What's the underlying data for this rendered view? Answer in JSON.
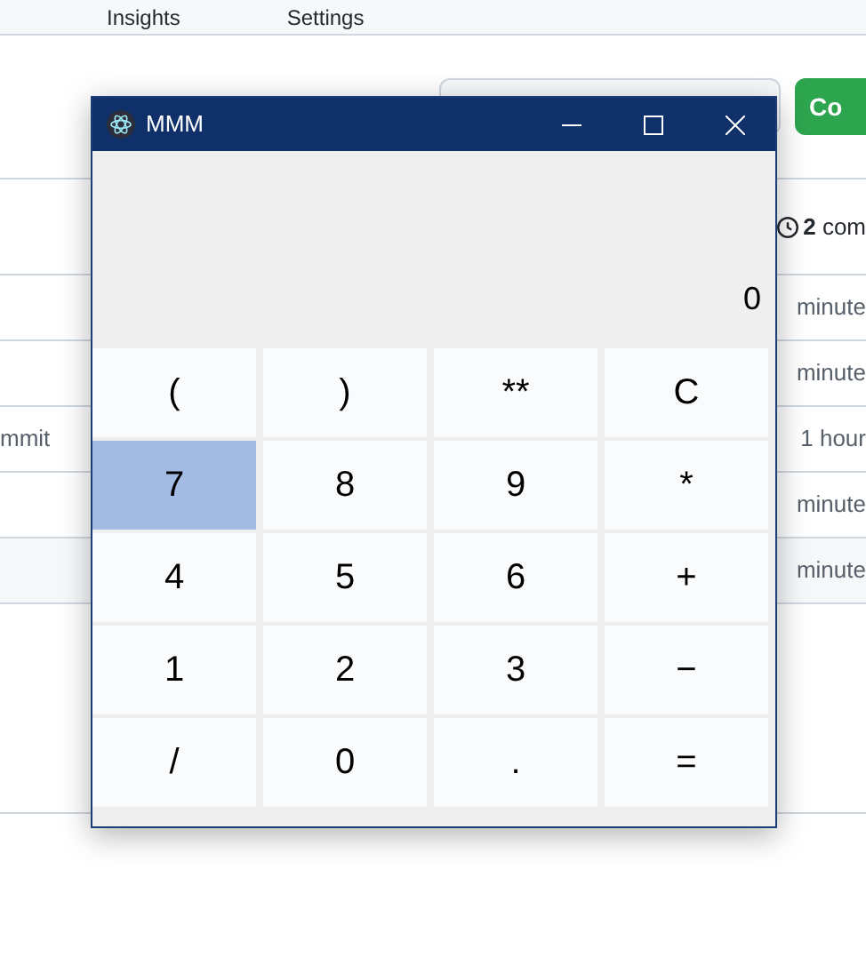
{
  "nav_tabs": [
    {
      "label": "Insights"
    },
    {
      "label": "Settings"
    }
  ],
  "header_button": {
    "label": "Co"
  },
  "history": {
    "count": "2",
    "label": "com"
  },
  "rows": [
    {
      "left": "",
      "right": "minute"
    },
    {
      "left": "",
      "right": "minute"
    },
    {
      "left": "mmit",
      "right": "1 hour"
    },
    {
      "left": "",
      "right": "minute"
    },
    {
      "left": "",
      "right": "minute"
    }
  ],
  "window": {
    "title": "MMM",
    "display": "0",
    "keys": [
      {
        "label": "(",
        "selected": false
      },
      {
        "label": ")",
        "selected": false
      },
      {
        "label": "**",
        "selected": false
      },
      {
        "label": "C",
        "selected": false
      },
      {
        "label": "7",
        "selected": true
      },
      {
        "label": "8",
        "selected": false
      },
      {
        "label": "9",
        "selected": false
      },
      {
        "label": "*",
        "selected": false
      },
      {
        "label": "4",
        "selected": false
      },
      {
        "label": "5",
        "selected": false
      },
      {
        "label": "6",
        "selected": false
      },
      {
        "label": "+",
        "selected": false
      },
      {
        "label": "1",
        "selected": false
      },
      {
        "label": "2",
        "selected": false
      },
      {
        "label": "3",
        "selected": false
      },
      {
        "label": "−",
        "selected": false
      },
      {
        "label": "/",
        "selected": false
      },
      {
        "label": "0",
        "selected": false
      },
      {
        "label": ".",
        "selected": false
      },
      {
        "label": "=",
        "selected": false
      }
    ]
  }
}
